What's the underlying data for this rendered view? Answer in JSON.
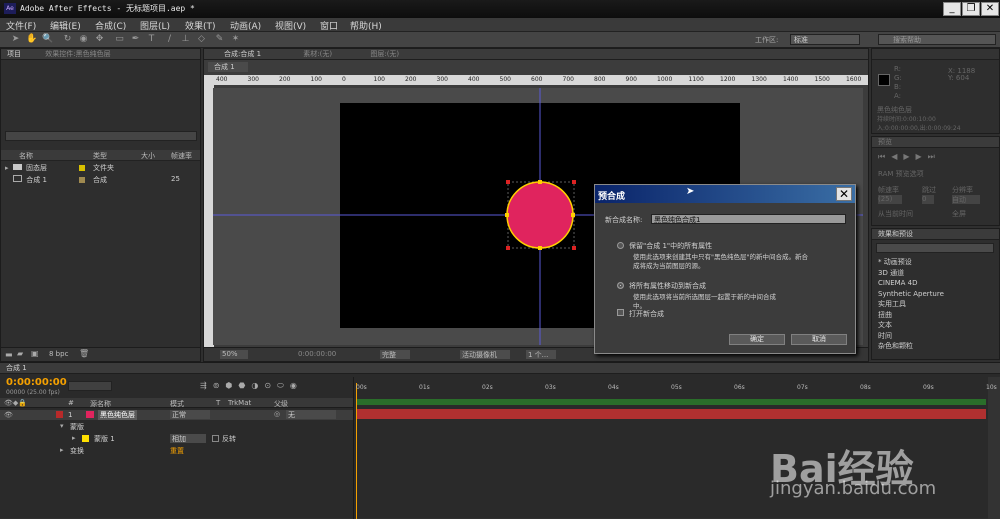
{
  "app": {
    "title": "Adobe After Effects - 无标题项目.aep *"
  },
  "menu": [
    "文件(F)",
    "编辑(E)",
    "合成(C)",
    "图层(L)",
    "效果(T)",
    "动画(A)",
    "视图(V)",
    "窗口",
    "帮助(H)"
  ],
  "workspace": {
    "label": "工作区:",
    "value": "标准",
    "search_placeholder": "搜索帮助"
  },
  "project": {
    "tab": "项目",
    "effects_tab": "效果控件:黑色纯色层",
    "columns": [
      "名称",
      "类型",
      "大小",
      "帧速率"
    ],
    "items": [
      {
        "name": "固态层",
        "type": "文件夹",
        "size": "",
        "fps": ""
      },
      {
        "name": "合成 1",
        "type": "合成",
        "size": "",
        "fps": "25"
      }
    ],
    "bpc": "8 bpc"
  },
  "composition": {
    "tab": "合成:合成 1",
    "footage_tab": "素材:(无)",
    "layer_tab": "图层:(无)",
    "crumb": "合成 1",
    "zoom": "50%",
    "timecode": "0:00:00:00",
    "resolution": "完整",
    "camera": "活动摄像机",
    "views": "1 个..."
  },
  "ruler": [
    "400",
    "300",
    "200",
    "100",
    "0",
    "100",
    "200",
    "300",
    "400",
    "500",
    "600",
    "700",
    "800",
    "900",
    "1000",
    "1100",
    "1200",
    "1300",
    "1400",
    "1500",
    "1600"
  ],
  "info": {
    "r": "R:",
    "g": "G:",
    "b": "B:",
    "a": "A:",
    "x": "X: 1188",
    "y": "Y: 604",
    "layer": "黑色纯色层",
    "duration": "持续时间:0:00:10:00",
    "inout": "入:0:00:00:00,出:0:00:09:24"
  },
  "preview": {
    "tab": "预览",
    "ram": "RAM 预览选项",
    "fps_label": "帧速率",
    "skip_label": "跳过",
    "res_label": "分辨率",
    "fps": "(25)",
    "skip": "0",
    "res": "自动",
    "from_current": "从当前时间",
    "fullscreen": "全屏"
  },
  "effects_presets": {
    "tab": "效果和预设",
    "items": [
      "* 动画预设",
      "3D 通道",
      "CINEMA 4D",
      "Synthetic Aperture",
      "实用工具",
      "扭曲",
      "文本",
      "时间",
      "杂色和颗粒"
    ]
  },
  "dialog": {
    "title": "预合成",
    "name_label": "新合成名称:",
    "name_value": "黑色纯色合成1",
    "opt1": "保留\"合成 1\"中的所有属性",
    "opt1_desc1": "使用此选项来创建其中只有\"黑色纯色层\"的新中间合成。新合",
    "opt1_desc2": "成将成为当前图层的源。",
    "opt2": "将所有属性移动到新合成",
    "opt2_desc1": "使用此选项将当前所选图层一起置于新的中间合成",
    "opt2_desc2": "中。",
    "open_label": "打开新合成",
    "ok": "确定",
    "cancel": "取消"
  },
  "timeline": {
    "tab": "合成 1",
    "timecode": "0:00:00:00",
    "fps_note": "00000 (25.00 fps)",
    "headers": [
      "#",
      "源名称",
      "模式",
      "T",
      "TrkMat",
      "父级"
    ],
    "layer": {
      "num": "1",
      "name": "黑色纯色层",
      "mode": "正常",
      "parent": "无"
    },
    "mask_group": "蒙版",
    "mask": "蒙版 1",
    "mask_mode": "相加",
    "invert": "反转",
    "transform": "变换",
    "reset": "重置",
    "ticks": [
      "00s",
      "01s",
      "02s",
      "03s",
      "04s",
      "05s",
      "06s",
      "07s",
      "08s",
      "09s",
      "10s"
    ]
  },
  "watermark": {
    "text": "Bai经验",
    "url": "jingyan.baidu.com"
  },
  "colors": {
    "layer_label": "#e0245e",
    "circle": "#e0245e",
    "circle_stroke": "#ffd000",
    "dialog_title": "#0a246a",
    "playhead": "#f4a000"
  }
}
